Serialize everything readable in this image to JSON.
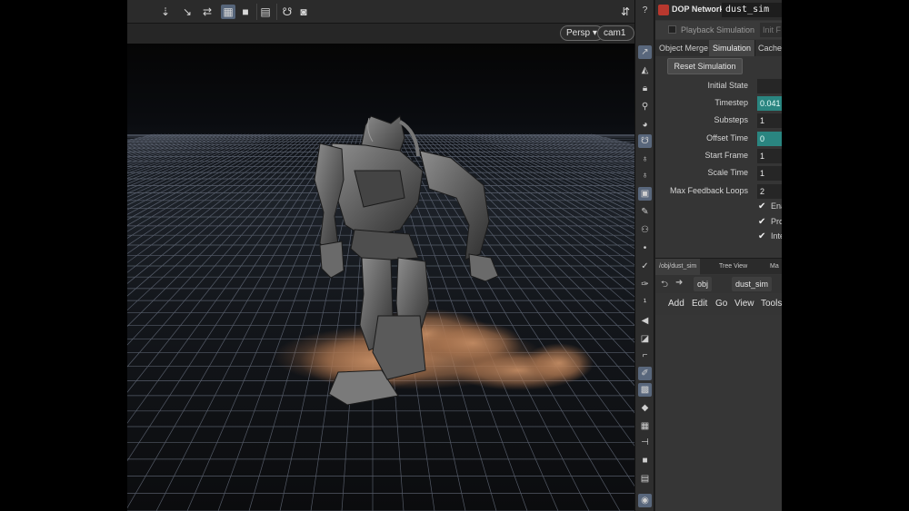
{
  "viewport": {
    "camera_menu": "Persp ▾",
    "cam_menu": "cam1 ▾",
    "toolbar_icons": [
      "snap-icon",
      "select-icon",
      "transform-icon",
      "grid-icon",
      "square-icon",
      "render-icon",
      "camera-icon",
      "handle-icon",
      "help-icon"
    ]
  },
  "dop": {
    "header_label": "DOP Network",
    "node_name": "dust_sim",
    "playback_label": "Playback Simulation",
    "playback_right": "Init F",
    "tabs": [
      "Object Merge",
      "Simulation",
      "Cache"
    ],
    "reset_button": "Reset Simulation",
    "params": [
      {
        "label": "Initial State",
        "value": ""
      },
      {
        "label": "Timestep",
        "value": "0.041",
        "highlight": true
      },
      {
        "label": "Substeps",
        "value": "1"
      },
      {
        "label": "Offset Time",
        "value": "0",
        "highlight": true
      },
      {
        "label": "Start Frame",
        "value": "1"
      },
      {
        "label": "Scale Time",
        "value": "1"
      },
      {
        "label": "Max Feedback Loops",
        "value": "2"
      }
    ],
    "checkboxes": [
      {
        "label": "Ena",
        "checked": true
      },
      {
        "label": "Pro",
        "checked": true
      },
      {
        "label": "Inte",
        "checked": true
      }
    ]
  },
  "network": {
    "tabs": [
      "/obj/dust_sim",
      "Tree View",
      "Ma"
    ],
    "path": [
      "obj",
      "dust_sim"
    ],
    "menu": [
      "Add",
      "Edit",
      "Go",
      "View",
      "Tools"
    ]
  },
  "colors": {
    "teal_field": "#2a8580",
    "dust": "#b07a55",
    "grid": "#6c7484"
  }
}
